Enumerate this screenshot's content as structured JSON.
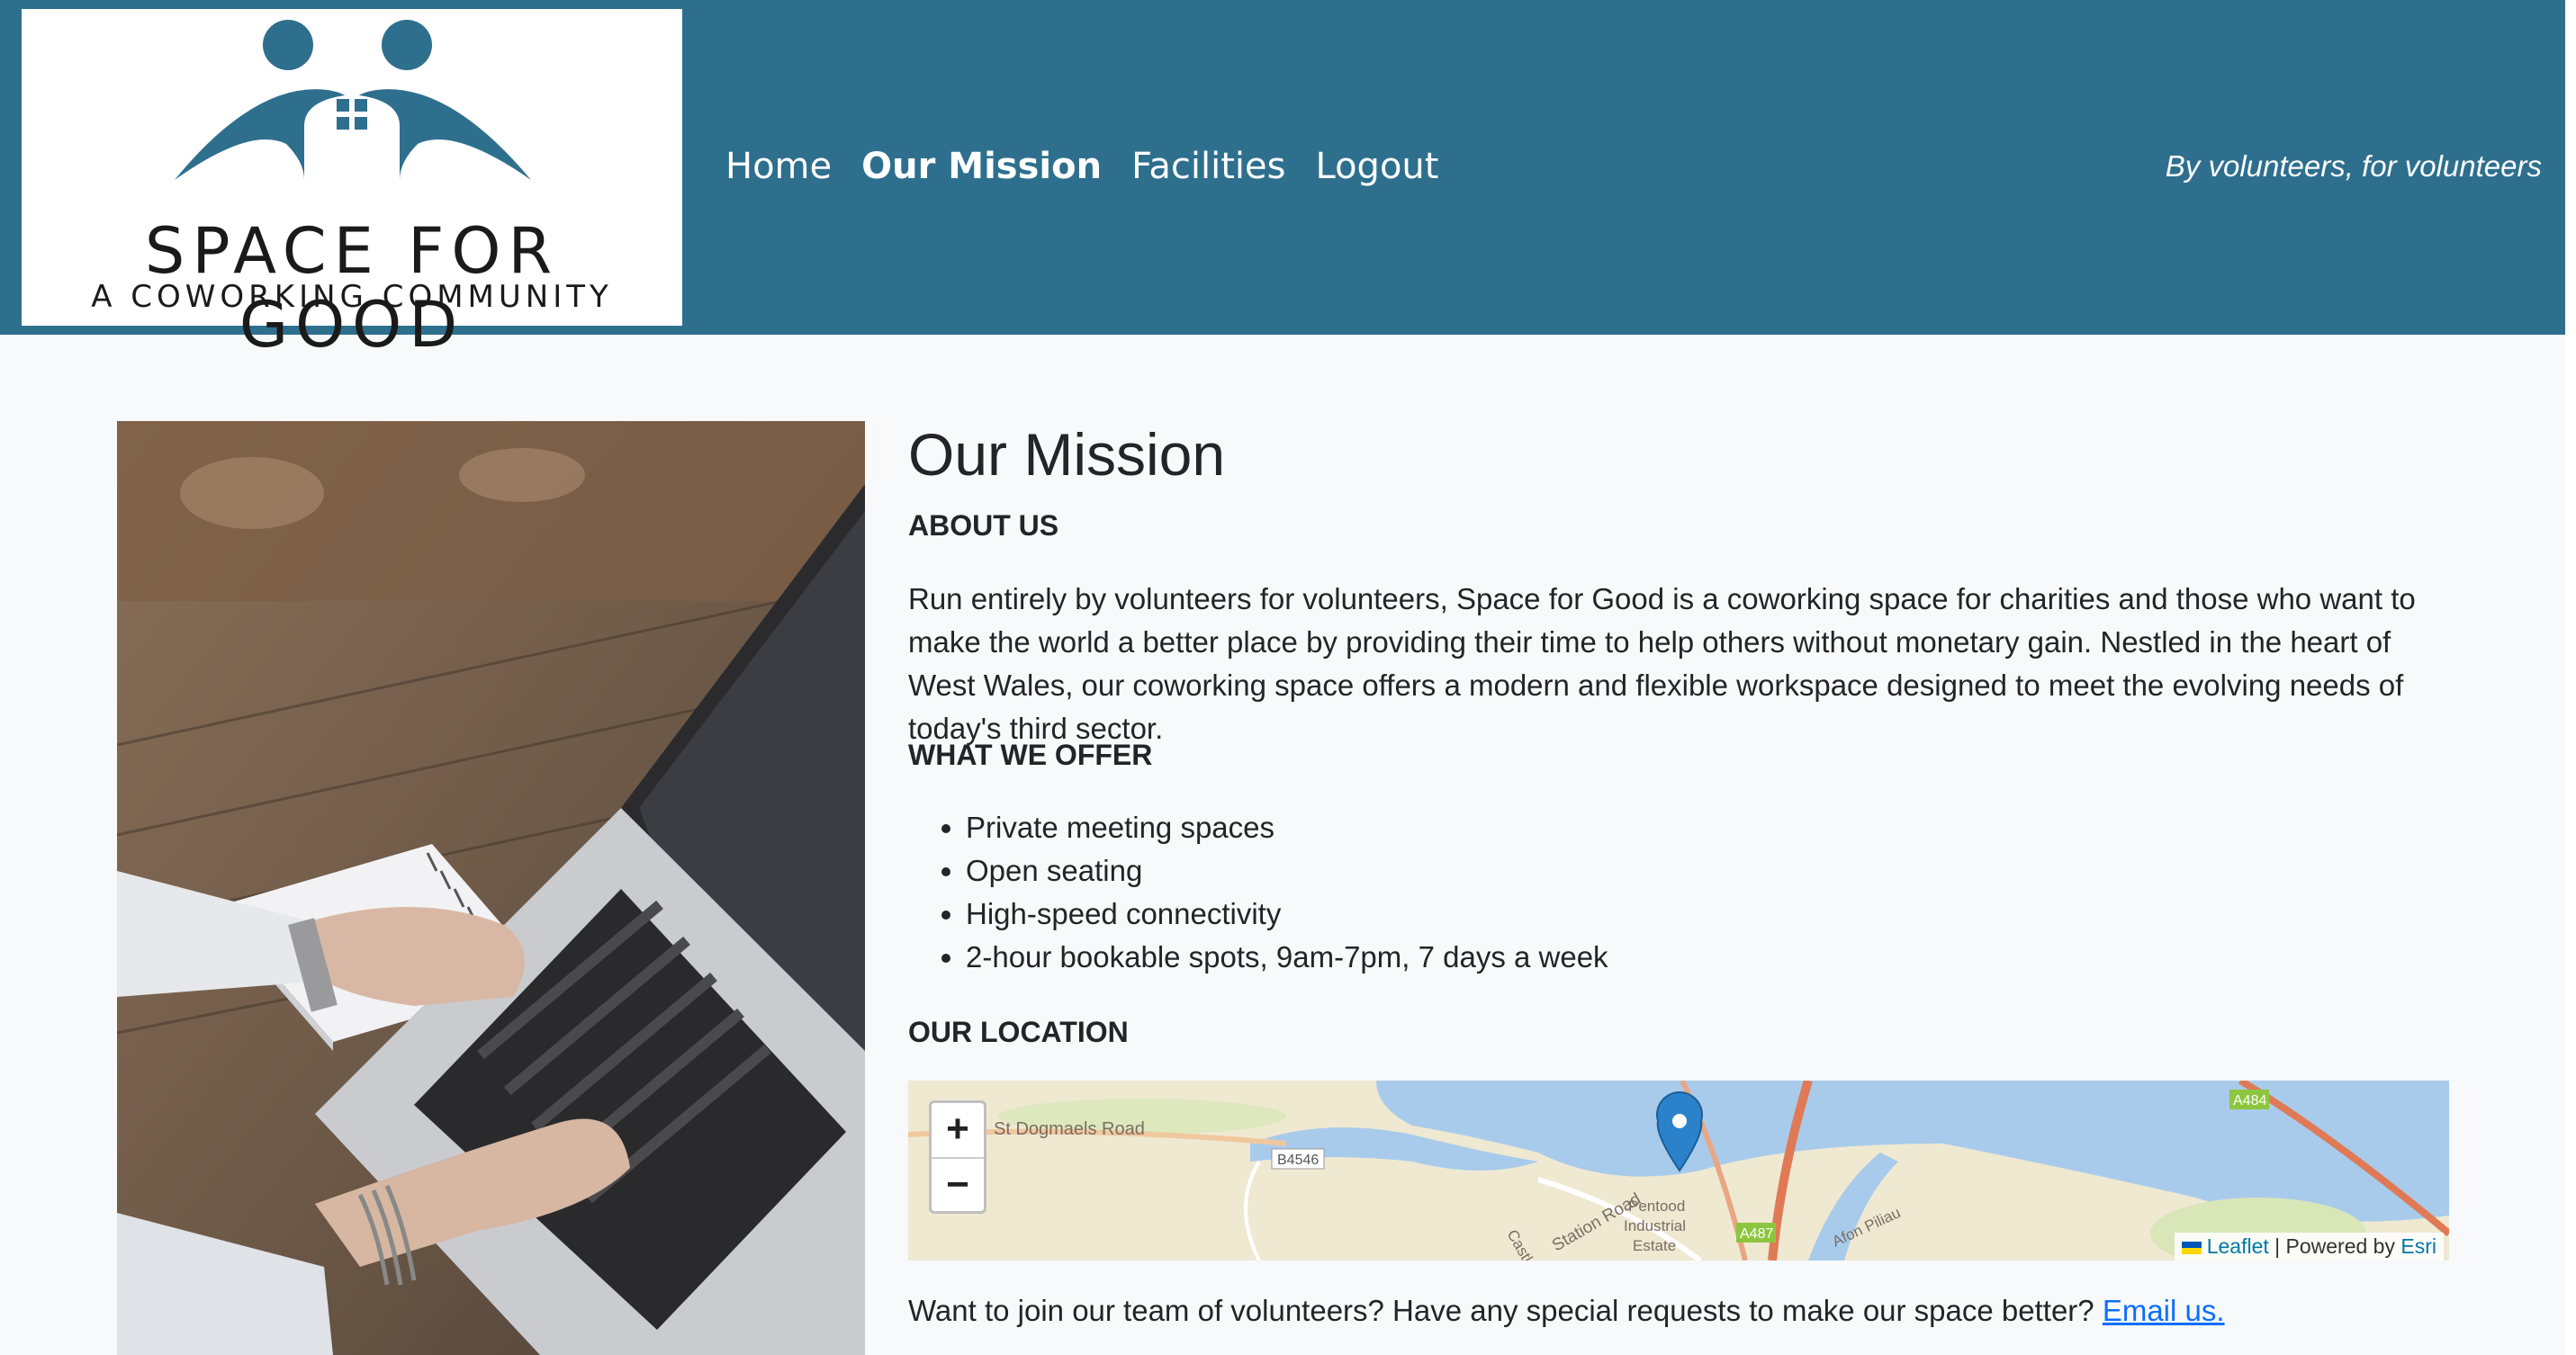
{
  "header": {
    "logo_title": "SPACE FOR GOOD",
    "logo_subtitle": "A COWORKING COMMUNITY",
    "nav": [
      {
        "label": "Home"
      },
      {
        "label": "Our Mission"
      },
      {
        "label": "Facilities"
      },
      {
        "label": "Logout"
      }
    ],
    "tagline": "By volunteers, for volunteers",
    "background_color": "#2e6f8e"
  },
  "main": {
    "title": "Our Mission",
    "about_heading": "ABOUT US",
    "about_text": "Run entirely by volunteers for volunteers, Space for Good is a coworking space for charities and those who want to make the world a better place by providing their time to help others without monetary gain. Nestled in the heart of West Wales, our coworking space offers a modern and flexible workspace designed to meet the evolving needs of today's third sector.",
    "offer_heading": "WHAT WE OFFER",
    "offer_items": [
      "Private meeting spaces",
      "Open seating",
      "High-speed connectivity",
      "2-hour bookable spots, 9am-7pm, 7 days a week"
    ],
    "location_heading": "OUR LOCATION",
    "join_text": "Want to join our team of volunteers? Have any special requests to make our space better?",
    "join_link": "Email us."
  },
  "map": {
    "zoom_in": "+",
    "zoom_out": "−",
    "attribution_leaflet": "Leaflet",
    "attribution_sep": " | Powered by ",
    "attribution_esri": "Esri",
    "labels": {
      "road1": "St Dogmaels Road",
      "road2": "B4546",
      "road3": "Station Road",
      "road4": "Castle",
      "area1": "Pentood",
      "area2": "Industrial",
      "area3": "Estate",
      "road5": "A487",
      "road6": "A484",
      "river": "Afon Piliau"
    }
  }
}
